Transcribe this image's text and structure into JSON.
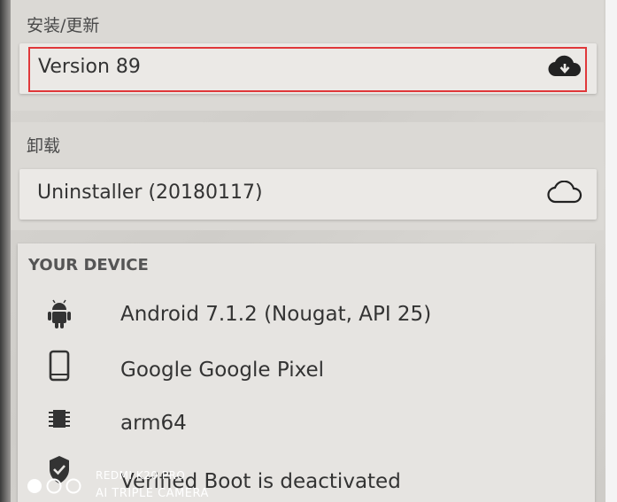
{
  "install_section": {
    "title": "安装/更新",
    "item_label": "Version 89",
    "item_icon": "cloud-download-icon"
  },
  "uninstall_section": {
    "title": "卸载",
    "item_label": "Uninstaller (20180117)",
    "item_icon": "cloud-icon"
  },
  "device_section": {
    "title": "YOUR DEVICE",
    "rows": [
      {
        "icon": "android-icon",
        "text": "Android 7.1.2 (Nougat, API 25)"
      },
      {
        "icon": "phone-icon",
        "text": "Google Google Pixel"
      },
      {
        "icon": "chip-icon",
        "text": "arm64"
      },
      {
        "icon": "shield-check-icon",
        "text": "Verified Boot is deactivated"
      }
    ]
  },
  "camera_watermark": {
    "line1": "REDMI K20 PRO",
    "line2": "AI TRIPLE CAMERA"
  },
  "colors": {
    "highlight": "#e0383a",
    "background": "#d8d6d2",
    "card": "#ebe9e6"
  }
}
